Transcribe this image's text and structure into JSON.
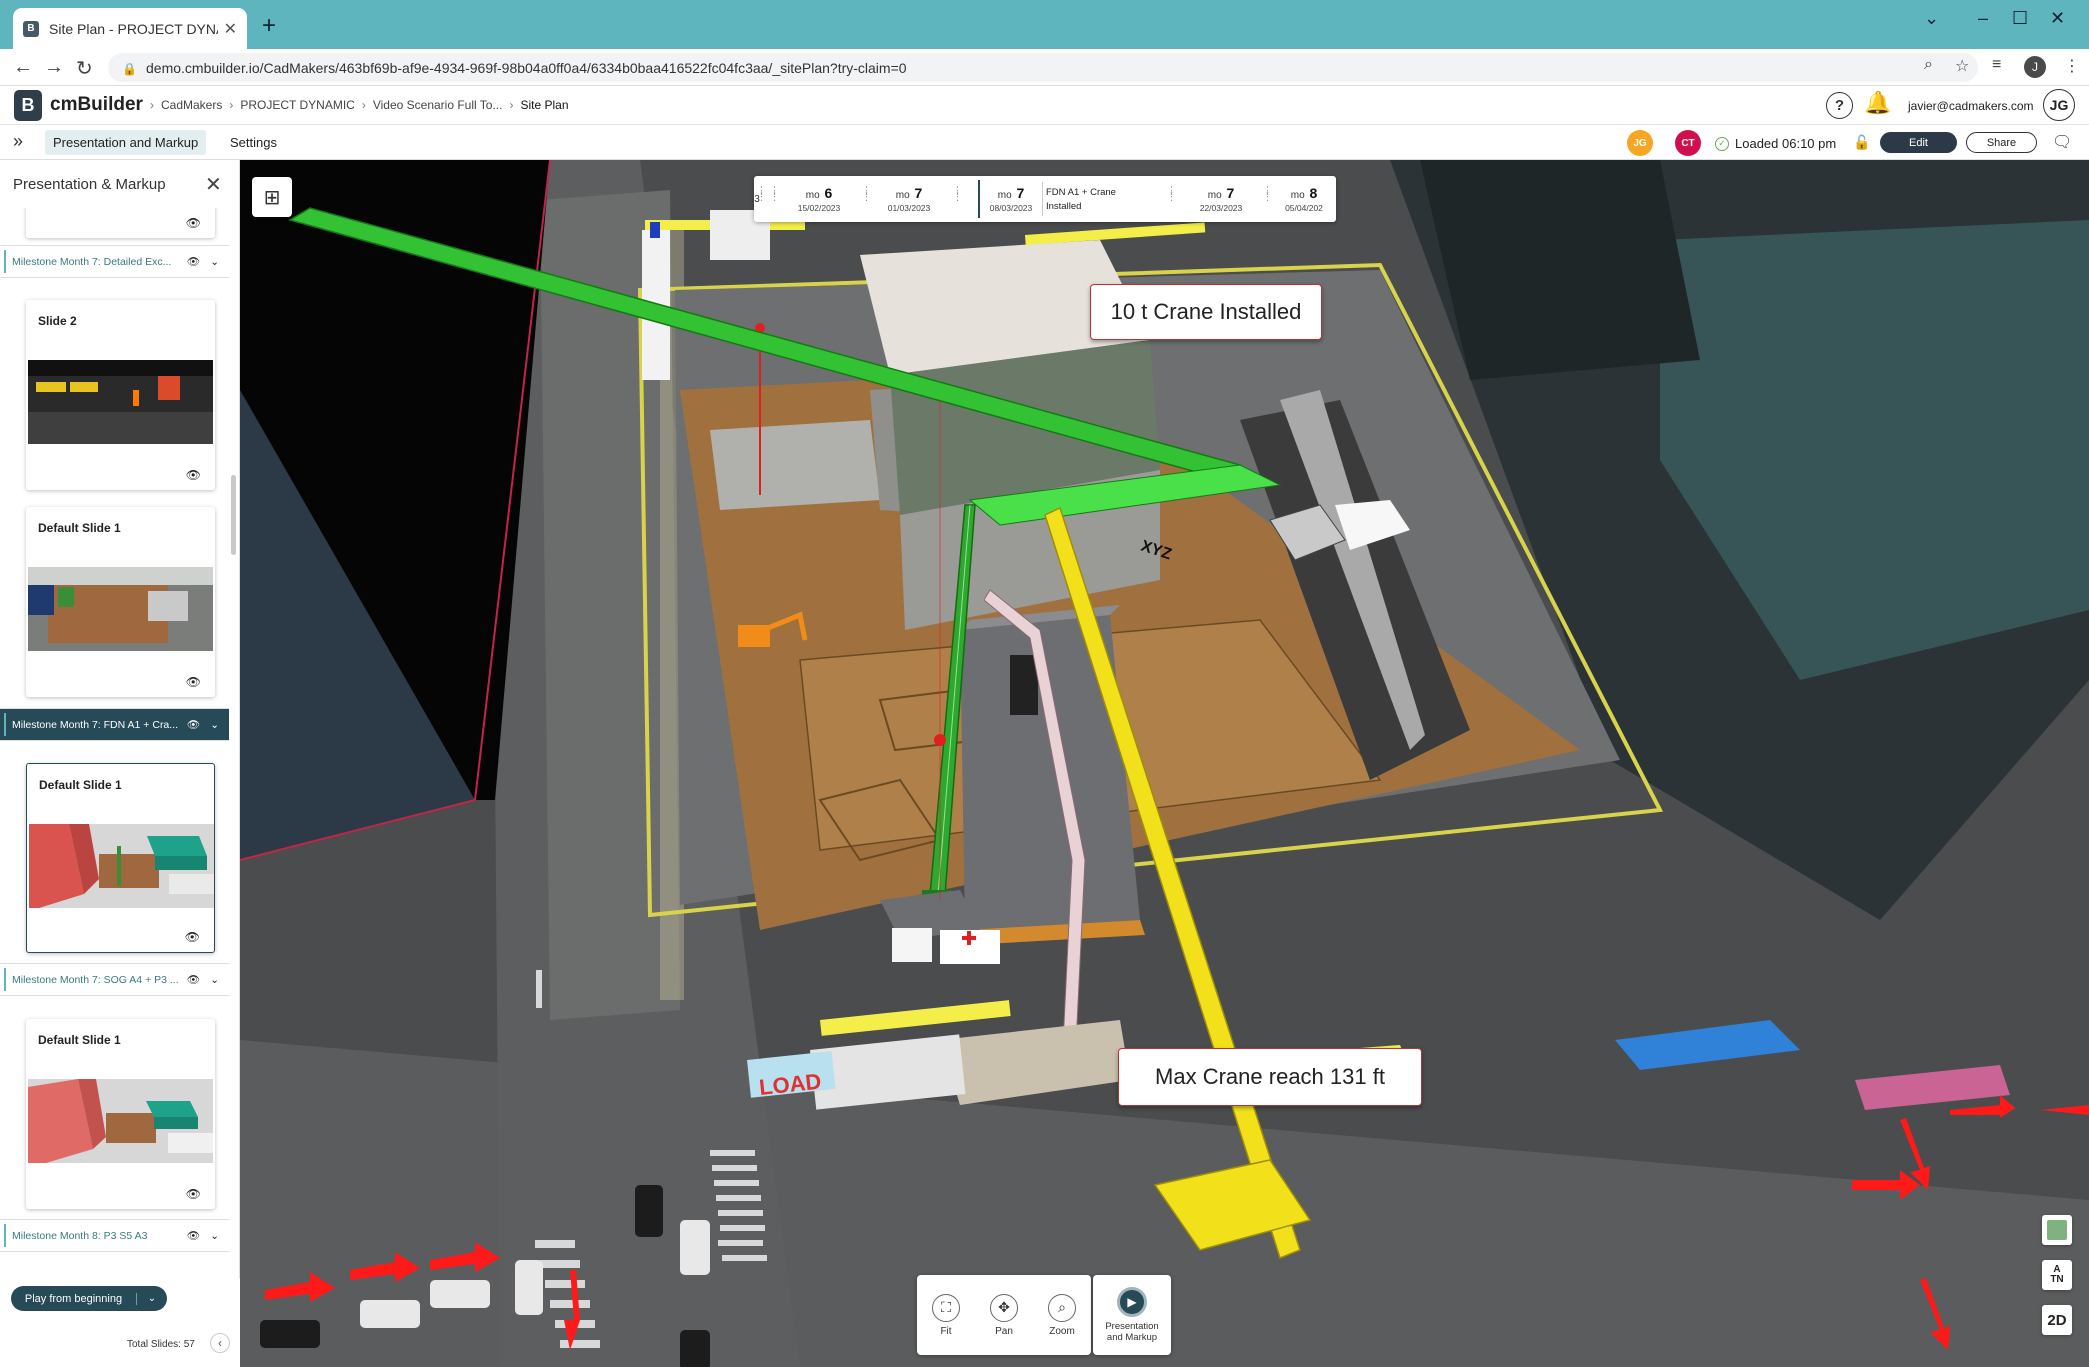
{
  "browser": {
    "tab_title": "Site Plan - PROJECT DYNAMIC | c",
    "url": "demo.cmbuilder.io/CadMakers/463bf69b-af9e-4934-969f-98b04a0ff0a4/6334b0baa416522fc04fc3aa/_sitePlan?try-claim=0",
    "profile_initial": "J"
  },
  "app": {
    "name": "cmBuilder",
    "logo_letter": "B",
    "breadcrumbs": [
      "CadMakers",
      "PROJECT DYNAMIC",
      "Video Scenario Full To...",
      "Site Plan"
    ],
    "user_email": "javier@cadmakers.com",
    "user_initials": "JG"
  },
  "toolbar": {
    "tabs": [
      "Presentation and Markup",
      "Settings"
    ],
    "collaborators": [
      {
        "initials": "JG",
        "color": "#f5a623"
      },
      {
        "initials": "CT",
        "color": "#d0104c"
      }
    ],
    "status": "Loaded 06:10 pm",
    "edit_label": "Edit",
    "share_label": "Share"
  },
  "panel": {
    "title": "Presentation & Markup",
    "milestones": [
      {
        "label": "Milestone Month 7: Detailed Exc...",
        "active": false
      },
      {
        "label": "Milestone Month 7: FDN A1 + Cra...",
        "active": true
      },
      {
        "label": "Milestone Month 7: SOG A4 + P3 ...",
        "active": false
      },
      {
        "label": "Milestone Month 8: P3 S5 A3",
        "active": false
      }
    ],
    "slides": [
      {
        "title": "Slide 2"
      },
      {
        "title": "Default Slide 1"
      },
      {
        "title": "Default Slide 1"
      },
      {
        "title": "Default Slide 1"
      }
    ],
    "play_label": "Play from beginning",
    "total_slides": "Total Slides: 57"
  },
  "timeline": {
    "items": [
      {
        "mo": "mo",
        "num": "6",
        "date": "15/02/2023"
      },
      {
        "mo": "mo",
        "num": "7",
        "date": "01/03/2023"
      },
      {
        "mo": "mo",
        "num": "7",
        "date": "08/03/2023"
      },
      {
        "mo": "mo",
        "num": "7",
        "date": "22/03/2023"
      },
      {
        "mo": "mo",
        "num": "8",
        "date": "05/04/202"
      }
    ],
    "active_label_1": "FDN A1 + Crane",
    "active_label_2": "Installed",
    "partial_left": "3"
  },
  "callouts": {
    "crane_installed": "10 t Crane Installed",
    "crane_reach": "Max Crane reach 131 ft"
  },
  "viewport_tools": [
    {
      "label": "Fit",
      "icon": "fit-icon"
    },
    {
      "label": "Pan",
      "icon": "pan-icon"
    },
    {
      "label": "Zoom",
      "icon": "zoom-icon"
    }
  ],
  "presentation_tool": {
    "line1": "Presentation",
    "line2": "and Markup"
  },
  "side_controls": {
    "north": "TN",
    "north_arrow": "A",
    "view_mode": "2D"
  },
  "scene_labels": {
    "load_sign": "LOAD",
    "crane_jib_text": "XYZ"
  }
}
